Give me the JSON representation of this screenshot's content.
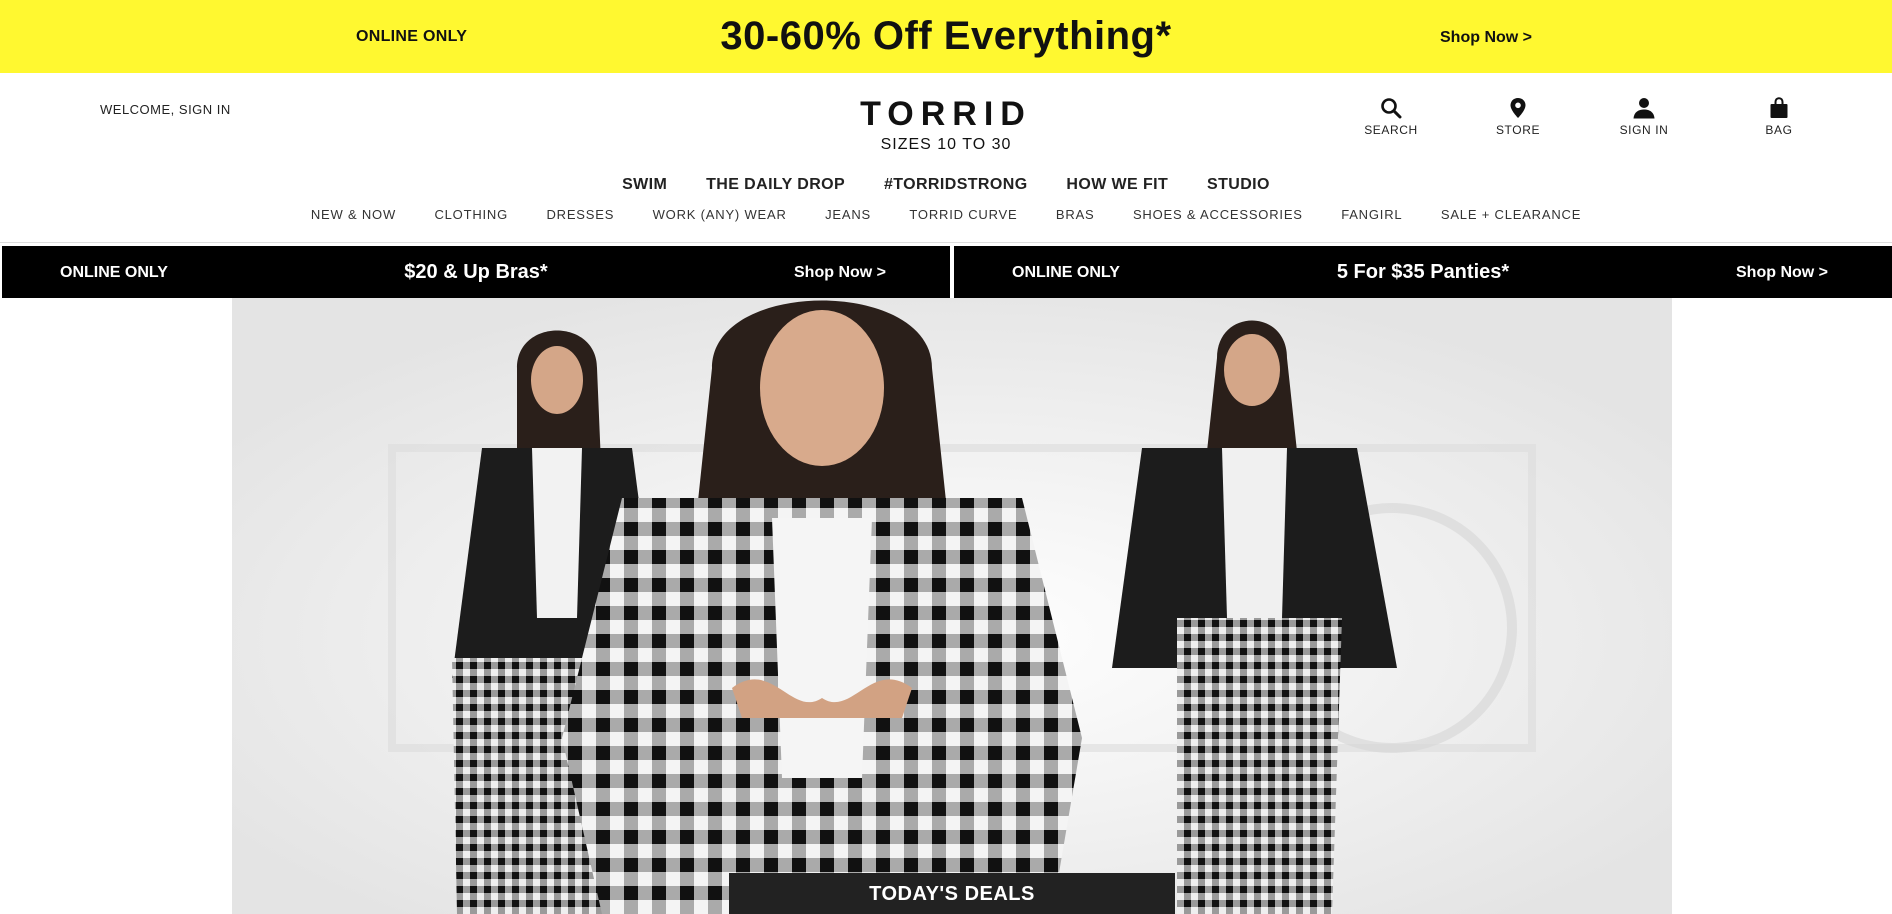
{
  "promo": {
    "left": "ONLINE ONLY",
    "center": "30-60% Off Everything*",
    "right": "Shop Now >"
  },
  "header": {
    "welcome": "WELCOME, SIGN IN",
    "brand": "TORRID",
    "tagline": "SIZES 10 TO 30",
    "utilities": {
      "search": "SEARCH",
      "store": "STORE",
      "signin": "SIGN IN",
      "bag": "BAG"
    }
  },
  "nav": {
    "primary": [
      "SWIM",
      "THE DAILY DROP",
      "#TORRIDSTRONG",
      "HOW WE FIT",
      "STUDIO"
    ],
    "secondary": [
      "NEW & NOW",
      "CLOTHING",
      "DRESSES",
      "WORK (ANY) WEAR",
      "JEANS",
      "TORRID CURVE",
      "BRAS",
      "SHOES & ACCESSORIES",
      "FANGIRL",
      "SALE + CLEARANCE"
    ]
  },
  "sub_promos": [
    {
      "tag": "ONLINE ONLY",
      "offer": "$20 & Up Bras*",
      "cta": "Shop Now >"
    },
    {
      "tag": "ONLINE ONLY",
      "offer": "5 For $35 Panties*",
      "cta": "Shop Now >"
    }
  ],
  "hero": {
    "button": "TODAY'S DEALS"
  },
  "colors": {
    "promo_bg": "#fff830",
    "bar_bg": "#000000",
    "deals_bg": "#222222"
  }
}
